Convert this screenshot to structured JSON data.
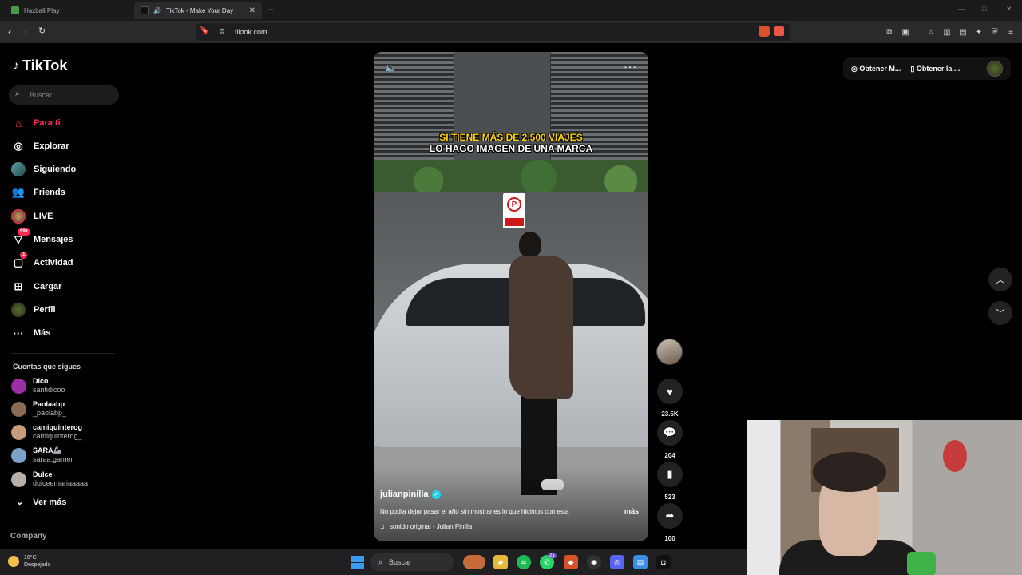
{
  "browser": {
    "tabs": [
      {
        "title": "Haxball Play",
        "active": false
      },
      {
        "title": "TikTok - Make Your Day",
        "active": true
      }
    ],
    "url": "tiktok.com"
  },
  "sidebar": {
    "logo": "TikTok",
    "search_placeholder": "Buscar",
    "nav": [
      {
        "label": "Para ti",
        "icon": "home-icon",
        "active": true
      },
      {
        "label": "Explorar",
        "icon": "compass-icon"
      },
      {
        "label": "Siguiendo",
        "icon": "following-avatar-icon"
      },
      {
        "label": "Friends",
        "icon": "friends-icon"
      },
      {
        "label": "LIVE",
        "icon": "live-avatar-icon"
      },
      {
        "label": "Mensajes",
        "icon": "messages-icon",
        "badge": "99+"
      },
      {
        "label": "Actividad",
        "icon": "activity-icon",
        "badge": "1"
      },
      {
        "label": "Cargar",
        "icon": "upload-icon"
      },
      {
        "label": "Perfil",
        "icon": "profile-avatar-icon"
      },
      {
        "label": "Más",
        "icon": "more-dots-icon"
      }
    ],
    "following_title": "Cuentas que sigues",
    "following": [
      {
        "name": "Dlco",
        "handle": "santidicoo",
        "color": "#9b2fa8"
      },
      {
        "name": "Paolaabp",
        "handle": "_paolabp_",
        "color": "#8a6a52"
      },
      {
        "name": "camiquinterog_",
        "handle": "camiquinterog_",
        "color": "#c79a7a"
      },
      {
        "name": "SARA🦾",
        "handle": "saraa.gamer",
        "color": "#7aa3c7"
      },
      {
        "name": "Dulce",
        "handle": "dulceemariaaaaa",
        "color": "#b8b0a8"
      }
    ],
    "see_more": "Ver más",
    "company": "Company"
  },
  "video": {
    "caption_line1": "SI TIENE MÁS DE 2.500 VIAJES",
    "caption_line2": "LO HAGO IMAGEN DE UNA MARCA",
    "sign_letter": "P",
    "author": "julianpinilla",
    "description": "No podía dejar pasar el año sin mostrarles lo que hicimos con esta",
    "more_label": "más",
    "music": "sonido original - Julian Pinilla"
  },
  "actions": {
    "likes": "23.5K",
    "comments": "204",
    "saves": "523",
    "shares": "100"
  },
  "topbar": {
    "btn1": "Obtener M...",
    "btn2": "Obtener la ..."
  },
  "taskbar": {
    "temp": "16°C",
    "weather": "Despejado",
    "search": "Buscar",
    "whatsapp_badge": "21"
  }
}
